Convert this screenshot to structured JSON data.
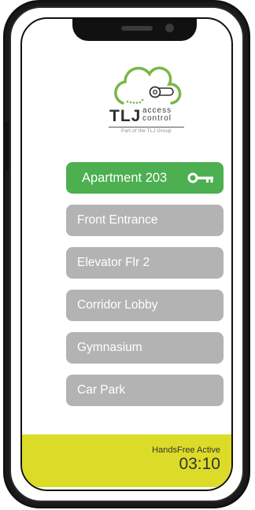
{
  "logo": {
    "brand": "TLJ",
    "sub_line1": "access",
    "sub_line2": "control",
    "tagline": "Part of the TLJ Group"
  },
  "doors": [
    {
      "label": "Apartment  203",
      "active": true,
      "icon": "key-icon"
    },
    {
      "label": "Front Entrance",
      "active": false
    },
    {
      "label": "Elevator Flr 2",
      "active": false
    },
    {
      "label": "Corridor Lobby",
      "active": false
    },
    {
      "label": "Gymnasium",
      "active": false
    },
    {
      "label": "Car Park",
      "active": false
    }
  ],
  "status": {
    "label": "HandsFree Active",
    "time": "03:10"
  },
  "colors": {
    "active_door": "#4caf50",
    "inactive_door": "#b3b3b3",
    "status_bar": "#dcdc28",
    "logo_cloud": "#7ab648"
  }
}
